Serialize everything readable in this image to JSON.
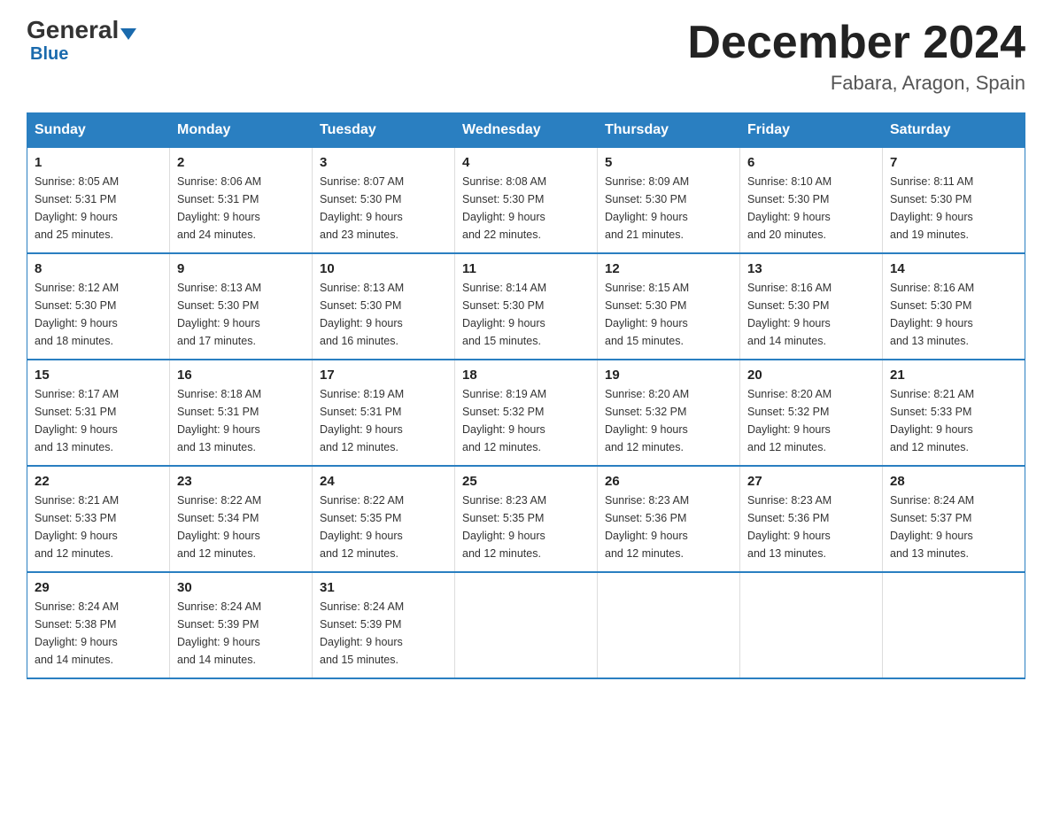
{
  "logo": {
    "general": "General",
    "triangle": "▲",
    "blue": "Blue"
  },
  "title": "December 2024",
  "subtitle": "Fabara, Aragon, Spain",
  "days_header": [
    "Sunday",
    "Monday",
    "Tuesday",
    "Wednesday",
    "Thursday",
    "Friday",
    "Saturday"
  ],
  "weeks": [
    [
      {
        "num": "1",
        "sunrise": "8:05 AM",
        "sunset": "5:31 PM",
        "daylight": "9 hours and 25 minutes."
      },
      {
        "num": "2",
        "sunrise": "8:06 AM",
        "sunset": "5:31 PM",
        "daylight": "9 hours and 24 minutes."
      },
      {
        "num": "3",
        "sunrise": "8:07 AM",
        "sunset": "5:30 PM",
        "daylight": "9 hours and 23 minutes."
      },
      {
        "num": "4",
        "sunrise": "8:08 AM",
        "sunset": "5:30 PM",
        "daylight": "9 hours and 22 minutes."
      },
      {
        "num": "5",
        "sunrise": "8:09 AM",
        "sunset": "5:30 PM",
        "daylight": "9 hours and 21 minutes."
      },
      {
        "num": "6",
        "sunrise": "8:10 AM",
        "sunset": "5:30 PM",
        "daylight": "9 hours and 20 minutes."
      },
      {
        "num": "7",
        "sunrise": "8:11 AM",
        "sunset": "5:30 PM",
        "daylight": "9 hours and 19 minutes."
      }
    ],
    [
      {
        "num": "8",
        "sunrise": "8:12 AM",
        "sunset": "5:30 PM",
        "daylight": "9 hours and 18 minutes."
      },
      {
        "num": "9",
        "sunrise": "8:13 AM",
        "sunset": "5:30 PM",
        "daylight": "9 hours and 17 minutes."
      },
      {
        "num": "10",
        "sunrise": "8:13 AM",
        "sunset": "5:30 PM",
        "daylight": "9 hours and 16 minutes."
      },
      {
        "num": "11",
        "sunrise": "8:14 AM",
        "sunset": "5:30 PM",
        "daylight": "9 hours and 15 minutes."
      },
      {
        "num": "12",
        "sunrise": "8:15 AM",
        "sunset": "5:30 PM",
        "daylight": "9 hours and 15 minutes."
      },
      {
        "num": "13",
        "sunrise": "8:16 AM",
        "sunset": "5:30 PM",
        "daylight": "9 hours and 14 minutes."
      },
      {
        "num": "14",
        "sunrise": "8:16 AM",
        "sunset": "5:30 PM",
        "daylight": "9 hours and 13 minutes."
      }
    ],
    [
      {
        "num": "15",
        "sunrise": "8:17 AM",
        "sunset": "5:31 PM",
        "daylight": "9 hours and 13 minutes."
      },
      {
        "num": "16",
        "sunrise": "8:18 AM",
        "sunset": "5:31 PM",
        "daylight": "9 hours and 13 minutes."
      },
      {
        "num": "17",
        "sunrise": "8:19 AM",
        "sunset": "5:31 PM",
        "daylight": "9 hours and 12 minutes."
      },
      {
        "num": "18",
        "sunrise": "8:19 AM",
        "sunset": "5:32 PM",
        "daylight": "9 hours and 12 minutes."
      },
      {
        "num": "19",
        "sunrise": "8:20 AM",
        "sunset": "5:32 PM",
        "daylight": "9 hours and 12 minutes."
      },
      {
        "num": "20",
        "sunrise": "8:20 AM",
        "sunset": "5:32 PM",
        "daylight": "9 hours and 12 minutes."
      },
      {
        "num": "21",
        "sunrise": "8:21 AM",
        "sunset": "5:33 PM",
        "daylight": "9 hours and 12 minutes."
      }
    ],
    [
      {
        "num": "22",
        "sunrise": "8:21 AM",
        "sunset": "5:33 PM",
        "daylight": "9 hours and 12 minutes."
      },
      {
        "num": "23",
        "sunrise": "8:22 AM",
        "sunset": "5:34 PM",
        "daylight": "9 hours and 12 minutes."
      },
      {
        "num": "24",
        "sunrise": "8:22 AM",
        "sunset": "5:35 PM",
        "daylight": "9 hours and 12 minutes."
      },
      {
        "num": "25",
        "sunrise": "8:23 AM",
        "sunset": "5:35 PM",
        "daylight": "9 hours and 12 minutes."
      },
      {
        "num": "26",
        "sunrise": "8:23 AM",
        "sunset": "5:36 PM",
        "daylight": "9 hours and 12 minutes."
      },
      {
        "num": "27",
        "sunrise": "8:23 AM",
        "sunset": "5:36 PM",
        "daylight": "9 hours and 13 minutes."
      },
      {
        "num": "28",
        "sunrise": "8:24 AM",
        "sunset": "5:37 PM",
        "daylight": "9 hours and 13 minutes."
      }
    ],
    [
      {
        "num": "29",
        "sunrise": "8:24 AM",
        "sunset": "5:38 PM",
        "daylight": "9 hours and 14 minutes."
      },
      {
        "num": "30",
        "sunrise": "8:24 AM",
        "sunset": "5:39 PM",
        "daylight": "9 hours and 14 minutes."
      },
      {
        "num": "31",
        "sunrise": "8:24 AM",
        "sunset": "5:39 PM",
        "daylight": "9 hours and 15 minutes."
      },
      null,
      null,
      null,
      null
    ]
  ],
  "labels": {
    "sunrise": "Sunrise:",
    "sunset": "Sunset:",
    "daylight": "Daylight:"
  },
  "colors": {
    "header_bg": "#2a7fc1",
    "border": "#2a7fc1",
    "logo_blue": "#1a6aad"
  }
}
